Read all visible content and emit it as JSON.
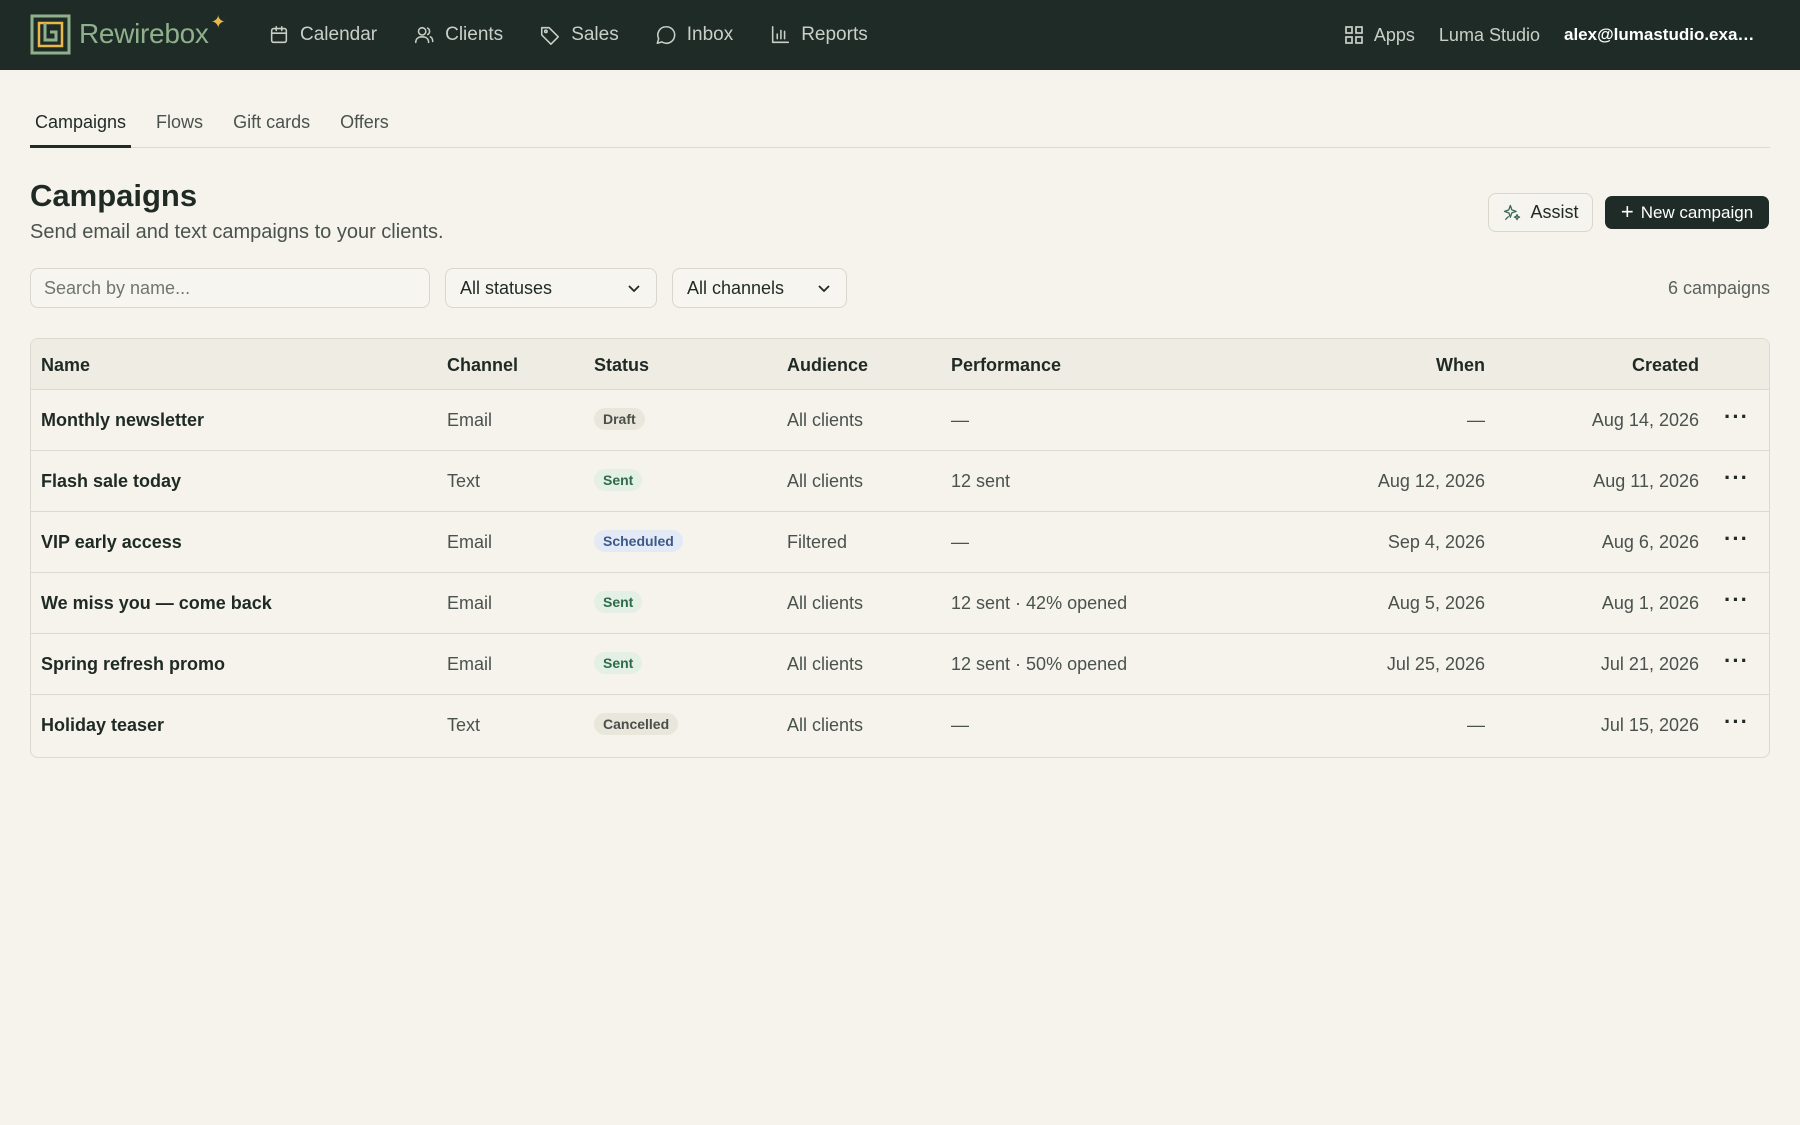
{
  "topbar": {
    "brand": "Rewirebox",
    "nav": [
      {
        "label": "Calendar",
        "icon": "calendar-icon"
      },
      {
        "label": "Clients",
        "icon": "users-icon"
      },
      {
        "label": "Sales",
        "icon": "tag-icon"
      },
      {
        "label": "Inbox",
        "icon": "chat-icon"
      },
      {
        "label": "Reports",
        "icon": "bar-chart-icon"
      }
    ],
    "apps_label": "Apps",
    "studio": "Luma Studio",
    "user_email": "alex@lumastudio.exam..."
  },
  "tabs": [
    {
      "label": "Campaigns",
      "active": true
    },
    {
      "label": "Flows",
      "active": false
    },
    {
      "label": "Gift cards",
      "active": false
    },
    {
      "label": "Offers",
      "active": false
    }
  ],
  "header": {
    "title": "Campaigns",
    "subtitle": "Send email and text campaigns to your clients.",
    "assist_label": "Assist",
    "new_label": "New campaign"
  },
  "filters": {
    "search_placeholder": "Search by name...",
    "status": "All statuses",
    "channel": "All channels",
    "count": "6 campaigns"
  },
  "table": {
    "headers": {
      "name": "Name",
      "channel": "Channel",
      "status": "Status",
      "audience": "Audience",
      "performance": "Performance",
      "when": "When",
      "created": "Created"
    },
    "rows": [
      {
        "name": "Monthly newsletter",
        "channel": "Email",
        "status": "Draft",
        "audience": "All clients",
        "performance": "—",
        "when": "—",
        "created": "Aug 14, 2026"
      },
      {
        "name": "Flash sale today",
        "channel": "Text",
        "status": "Sent",
        "audience": "All clients",
        "performance": "12 sent",
        "when": "Aug 12, 2026",
        "created": "Aug 11, 2026"
      },
      {
        "name": "VIP early access",
        "channel": "Email",
        "status": "Scheduled",
        "audience": "Filtered",
        "performance": "—",
        "when": "Sep 4, 2026",
        "created": "Aug 6, 2026"
      },
      {
        "name": "We miss you — come back",
        "channel": "Email",
        "status": "Sent",
        "audience": "All clients",
        "performance": "12 sent · 42% opened",
        "when": "Aug 5, 2026",
        "created": "Aug 1, 2026"
      },
      {
        "name": "Spring refresh promo",
        "channel": "Email",
        "status": "Sent",
        "audience": "All clients",
        "performance": "12 sent · 50% opened",
        "when": "Jul 25, 2026",
        "created": "Jul 21, 2026"
      },
      {
        "name": "Holiday teaser",
        "channel": "Text",
        "status": "Cancelled",
        "audience": "All clients",
        "performance": "—",
        "when": "—",
        "created": "Jul 15, 2026"
      }
    ]
  },
  "status_colors": {
    "Draft": {
      "bg": "#e9e6dc",
      "fg": "#4a4f4a"
    },
    "Sent": {
      "bg": "#e4efe6",
      "fg": "#2f6b4a"
    },
    "Scheduled": {
      "bg": "#e3eaf5",
      "fg": "#3b5a8a"
    },
    "Cancelled": {
      "bg": "#e9e6dc",
      "fg": "#4a4f4a"
    }
  }
}
